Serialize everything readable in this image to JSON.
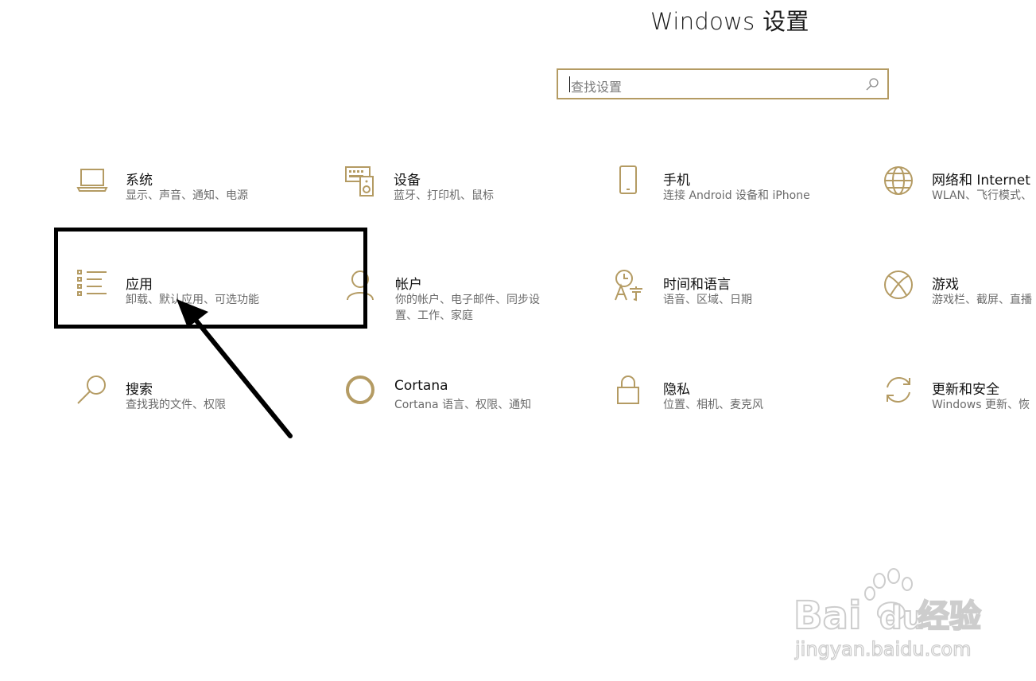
{
  "window": {
    "title": "Windows 设置"
  },
  "search": {
    "placeholder": "查找设置",
    "icon": "search-icon"
  },
  "accent_color": "#b49b63",
  "tiles": [
    {
      "name": "系统",
      "desc": "显示、声音、通知、电源",
      "icon": "laptop-icon"
    },
    {
      "name": "设备",
      "desc": "蓝牙、打印机、鼠标",
      "icon": "keyboard-speaker-icon"
    },
    {
      "name": "手机",
      "desc": "连接 Android 设备和 iPhone",
      "icon": "phone-icon"
    },
    {
      "name": "网络和 Internet",
      "desc": "WLAN、飞行模式、",
      "icon": "globe-icon"
    },
    {
      "name": "应用",
      "desc": "卸载、默认应用、可选功能",
      "icon": "apps-list-icon"
    },
    {
      "name": "帐户",
      "desc": "你的帐户、电子邮件、同步设置、工作、家庭",
      "icon": "person-icon"
    },
    {
      "name": "时间和语言",
      "desc": "语音、区域、日期",
      "icon": "time-language-icon"
    },
    {
      "name": "游戏",
      "desc": "游戏栏、截屏、直播",
      "icon": "xbox-icon"
    },
    {
      "name": "搜索",
      "desc": "查找我的文件、权限",
      "icon": "search-magnifier-icon"
    },
    {
      "name": "Cortana",
      "desc": "Cortana 语言、权限、通知",
      "icon": "cortana-ring-icon"
    },
    {
      "name": "隐私",
      "desc": "位置、相机、麦克风",
      "icon": "lock-icon"
    },
    {
      "name": "更新和安全",
      "desc": "Windows 更新、恢",
      "icon": "sync-icon"
    }
  ],
  "watermark": {
    "brand": "Bai",
    "brand2": "du",
    "cn": "经验",
    "url": "jingyan.baidu.com"
  }
}
